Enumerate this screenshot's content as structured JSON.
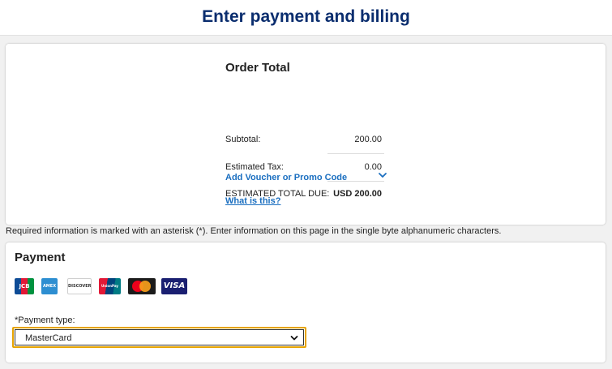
{
  "header": {
    "title": "Enter payment and billing"
  },
  "order": {
    "title": "Order Total",
    "subtotal_label": "Subtotal:",
    "subtotal_value": "200.00",
    "tax_label": "Estimated Tax:",
    "tax_value": "0.00",
    "total_label": "ESTIMATED TOTAL DUE:",
    "total_value": "USD 200.00",
    "promo_link": "Add Voucher or Promo Code",
    "what_link": "What is this?"
  },
  "notice": "Required information is marked with an asterisk (*). Enter information on this page in the single byte alphanumeric characters.",
  "payment": {
    "title": "Payment",
    "cards": [
      {
        "name": "JCB",
        "label": "JCB"
      },
      {
        "name": "American Express",
        "label": "AMEX"
      },
      {
        "name": "Discover",
        "label": "DISCOVER"
      },
      {
        "name": "UnionPay",
        "label": "UnionPay"
      },
      {
        "name": "MasterCard",
        "label": "mastercard"
      },
      {
        "name": "Visa",
        "label": "VISA"
      }
    ],
    "type_label": "*Payment type:",
    "type_selected": "MasterCard"
  },
  "colors": {
    "title_navy": "#0a2d6e",
    "link_blue": "#1b6fc0",
    "focus_amber": "#e6a300",
    "page_bg": "#f1f1f1"
  },
  "icons": {
    "promo_toggle": "chevron-down-icon",
    "select_arrow": "chevron-down-icon"
  }
}
